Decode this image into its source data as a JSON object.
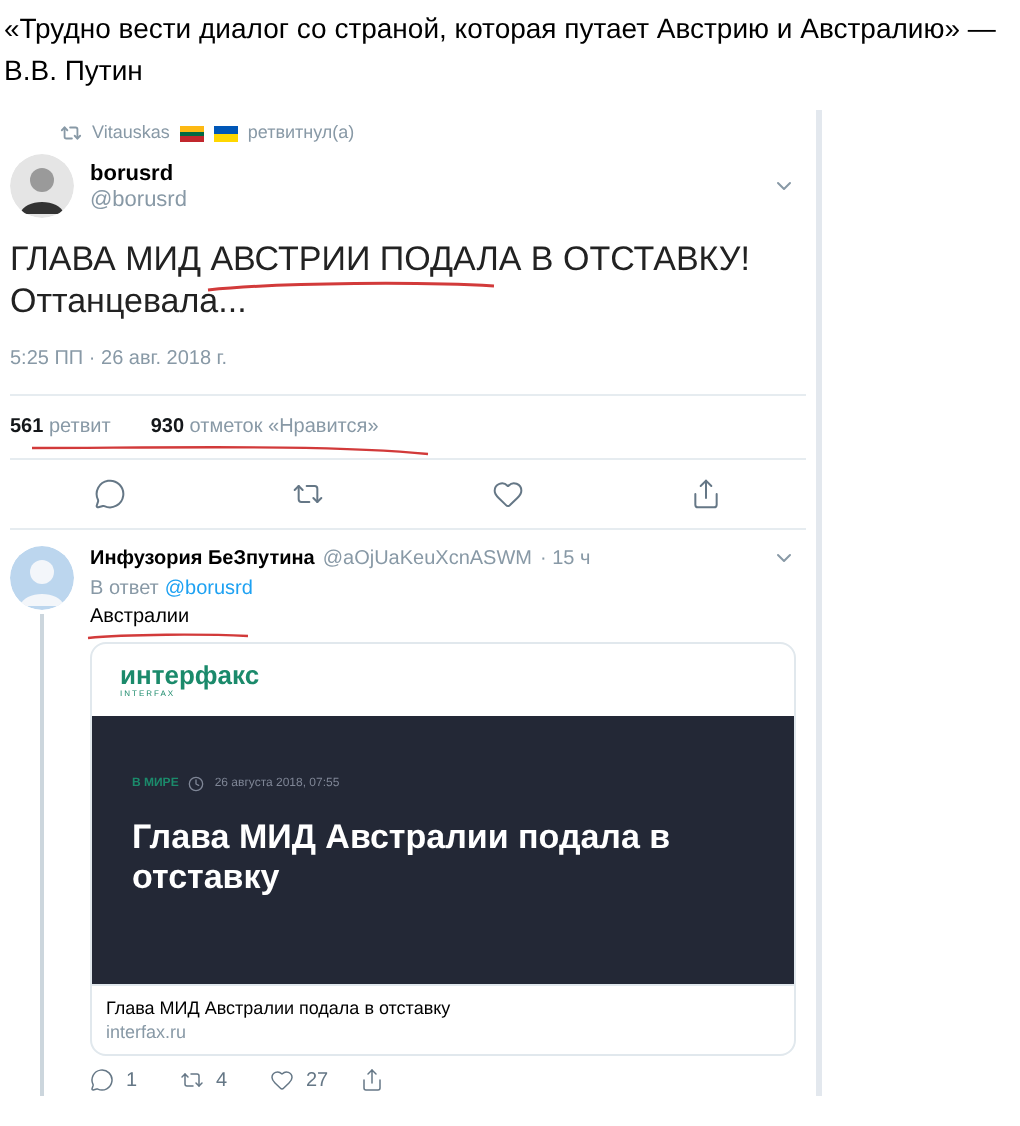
{
  "caption": "«Трудно вести диалог со страной, которая путает Австрию и Австралию» — В.В. Путин",
  "tweet": {
    "retweeted_by": "Vitauskas",
    "retweeted_label": "ретвитнул(а)",
    "name": "borusrd",
    "handle": "@borusrd",
    "text_line_1": "ГЛАВА МИД АВСТРИИ ПОДАЛА В ОТСТАВКУ!",
    "text_line_2": "Оттанцевала...",
    "time": "5:25 ПП · 26 авг. 2018 г.",
    "stats": [
      {
        "count": "561",
        "label": "ретвит"
      },
      {
        "count": "930",
        "label": "отметок «Нравится»"
      }
    ]
  },
  "reply": {
    "name": "Инфузория БеЗпутина",
    "handle": "@aOjUaKeuXcnASWM",
    "age": "· 15 ч",
    "in_reply_label": "В ответ",
    "in_reply_handle": "@borusrd",
    "text": "Австралии",
    "card": {
      "logo": "интерфакс",
      "logo_sub": "INTERFAX",
      "section": "В МИРЕ",
      "date": "26 августа 2018, 07:55",
      "headline": "Глава МИД Австралии подала в отставку",
      "title": "Глава МИД Австралии подала в отставку",
      "domain": "interfax.ru"
    },
    "actions": [
      {
        "kind": "reply",
        "count": "1"
      },
      {
        "kind": "retweet",
        "count": "4"
      },
      {
        "kind": "like",
        "count": "27"
      },
      {
        "kind": "share"
      }
    ]
  }
}
